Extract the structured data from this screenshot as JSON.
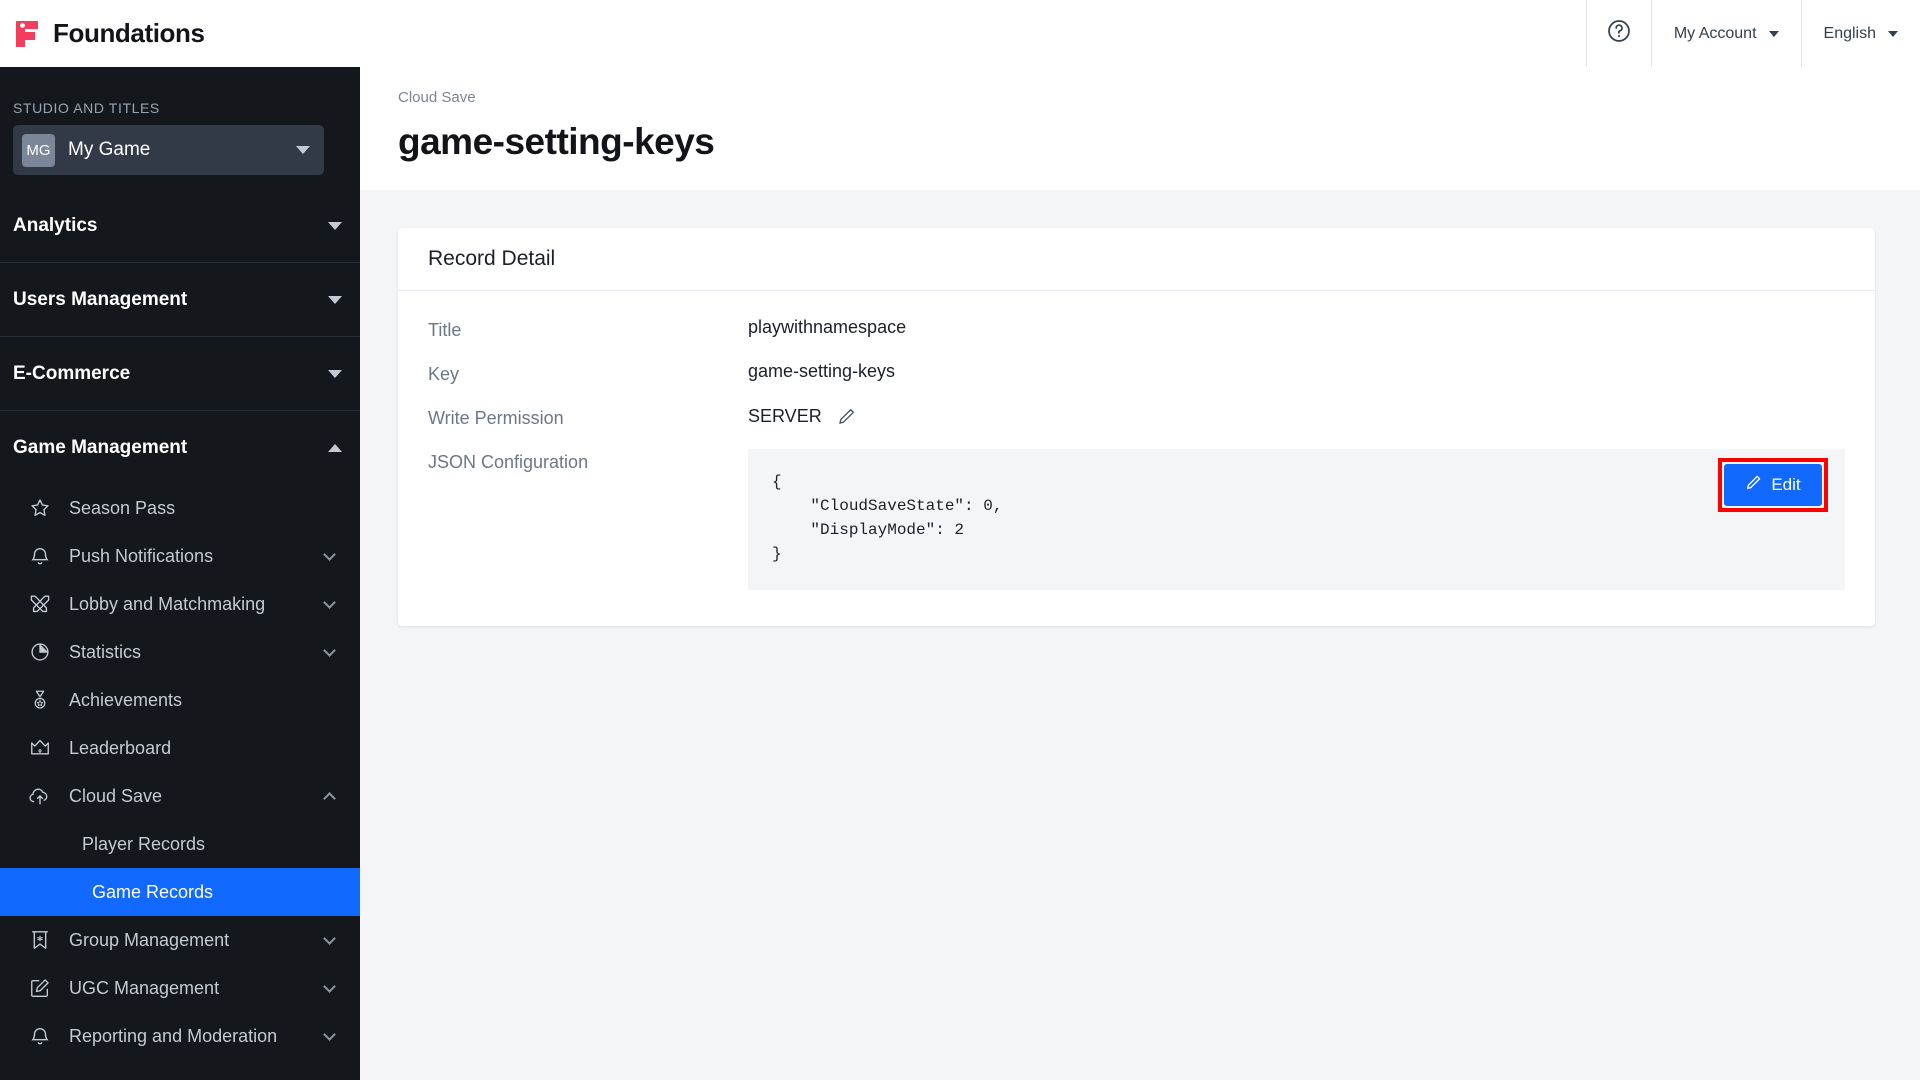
{
  "brand": {
    "name": "Foundations",
    "logo_icon": "foundations-logo-icon",
    "accent": "#f23d5c"
  },
  "topbar": {
    "help_icon": "help-circle-icon",
    "account_label": "My Account",
    "language_label": "English"
  },
  "sidebar": {
    "studio_label": "STUDIO AND TITLES",
    "studio": {
      "initials": "MG",
      "name": "My Game"
    },
    "groups": [
      {
        "label": "Analytics",
        "expanded": false
      },
      {
        "label": "Users Management",
        "expanded": false
      },
      {
        "label": "E-Commerce",
        "expanded": false
      },
      {
        "label": "Game Management",
        "expanded": true
      }
    ],
    "items": [
      {
        "label": "Season Pass",
        "icon": "star-icon",
        "chevron": "none"
      },
      {
        "label": "Push Notifications",
        "icon": "bell-icon",
        "chevron": "down"
      },
      {
        "label": "Lobby and Matchmaking",
        "icon": "swords-icon",
        "chevron": "down"
      },
      {
        "label": "Statistics",
        "icon": "pie-chart-icon",
        "chevron": "down"
      },
      {
        "label": "Achievements",
        "icon": "medal-icon",
        "chevron": "none"
      },
      {
        "label": "Leaderboard",
        "icon": "crown-icon",
        "chevron": "none"
      },
      {
        "label": "Cloud Save",
        "icon": "cloud-upload-icon",
        "chevron": "up"
      }
    ],
    "cloud_save_children": [
      {
        "label": "Player Records",
        "active": false
      },
      {
        "label": "Game Records",
        "active": true
      }
    ],
    "items_after": [
      {
        "label": "Group Management",
        "icon": "banner-icon",
        "chevron": "down"
      },
      {
        "label": "UGC Management",
        "icon": "edit-square-icon",
        "chevron": "down"
      },
      {
        "label": "Reporting and Moderation",
        "icon": "bell-icon",
        "chevron": "down"
      }
    ],
    "active_color": "#1269ff"
  },
  "page": {
    "breadcrumb": "Cloud Save",
    "title": "game-setting-keys"
  },
  "card": {
    "header": "Record Detail",
    "fields": {
      "title_label": "Title",
      "title_value": "playwithnamespace",
      "key_label": "Key",
      "key_value": "game-setting-keys",
      "write_permission_label": "Write Permission",
      "write_permission_value": "SERVER",
      "write_permission_edit_icon": "pencil-icon",
      "json_label": "JSON Configuration",
      "json_value": "{\n    \"CloudSaveState\": 0,\n    \"DisplayMode\": 2\n}"
    },
    "edit_button": {
      "label": "Edit",
      "icon": "pencil-icon",
      "color": "#1269ff",
      "highlight_color": "#ff0000"
    }
  }
}
